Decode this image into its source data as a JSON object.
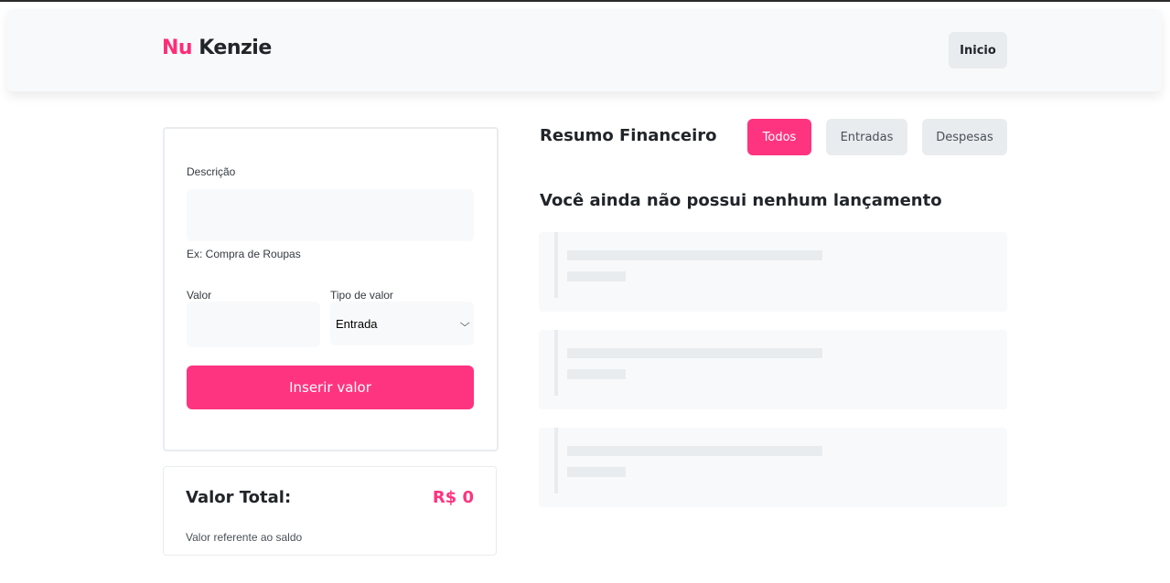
{
  "header": {
    "logo_nu": "Nu",
    "logo_kenzie": "Kenzie",
    "inicio_label": "Inicio"
  },
  "form": {
    "descricao_label": "Descrição",
    "descricao_value": "",
    "descricao_hint": "Ex: Compra de Roupas",
    "valor_label": "Valor",
    "valor_value": "",
    "tipo_label": "Tipo de valor",
    "tipo_selected": "Entrada",
    "submit_label": "Inserir valor"
  },
  "total": {
    "label": "Valor Total:",
    "value": "R$ 0",
    "hint": "Valor referente ao saldo"
  },
  "resumo": {
    "title": "Resumo Financeiro",
    "filters": [
      "Todos",
      "Entradas",
      "Despesas"
    ],
    "active_filter": "Todos",
    "empty_message": "Você ainda não possui nenhum lançamento"
  },
  "colors": {
    "accent": "#ff3480",
    "logo_nu": "#ff2d78",
    "neutral_button": "#e9ecef",
    "placeholder_bg": "#f8f9fa"
  },
  "icons": {
    "select_arrow": "chevron-down-icon"
  }
}
